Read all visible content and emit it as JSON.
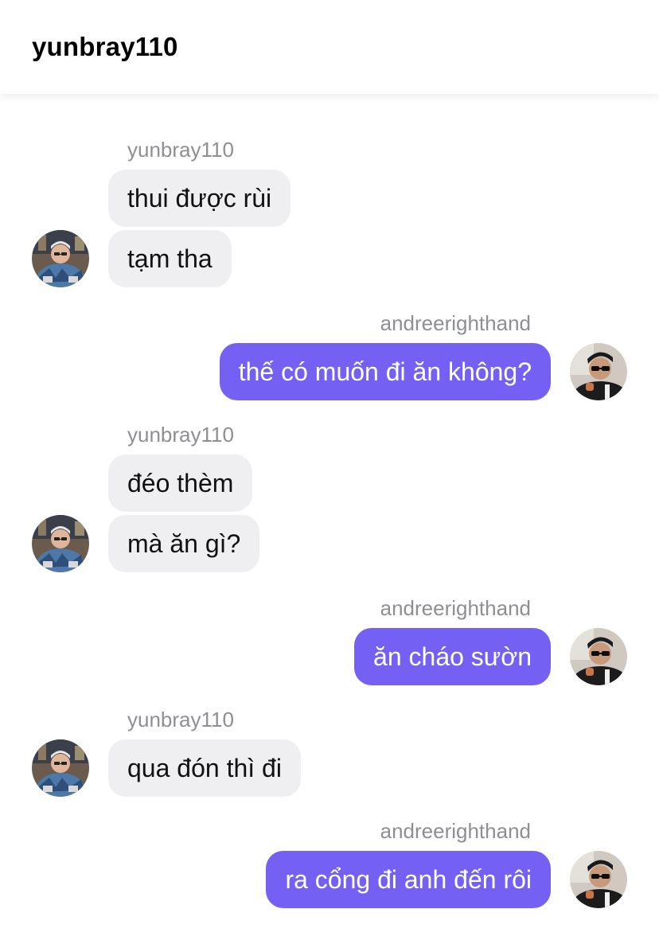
{
  "header": {
    "title": "yunbray110"
  },
  "contacts": {
    "left": {
      "name": "yunbray110",
      "avatar_icon": "yunbray110-avatar"
    },
    "right": {
      "name": "andreerighthand",
      "avatar_icon": "andreerighthand-avatar"
    }
  },
  "messages": [
    {
      "side": "left",
      "sender": "yunbray110",
      "bubbles": [
        "thui được rùi",
        "tạm tha"
      ]
    },
    {
      "side": "right",
      "sender": "andreerighthand",
      "bubbles": [
        "thế có muốn đi ăn không?"
      ]
    },
    {
      "side": "left",
      "sender": "yunbray110",
      "bubbles": [
        "đéo thèm",
        "mà ăn gì?"
      ]
    },
    {
      "side": "right",
      "sender": "andreerighthand",
      "bubbles": [
        "ăn cháo sườn"
      ]
    },
    {
      "side": "left",
      "sender": "yunbray110",
      "bubbles": [
        "qua đón thì đi"
      ]
    },
    {
      "side": "right",
      "sender": "andreerighthand",
      "bubbles": [
        "ra cổng đi anh đến rôi"
      ]
    }
  ],
  "colors": {
    "outgoing_bubble": "#7560f4",
    "incoming_bubble": "#efeff2",
    "sender_label": "#8e8e93",
    "background": "#ffffff"
  }
}
